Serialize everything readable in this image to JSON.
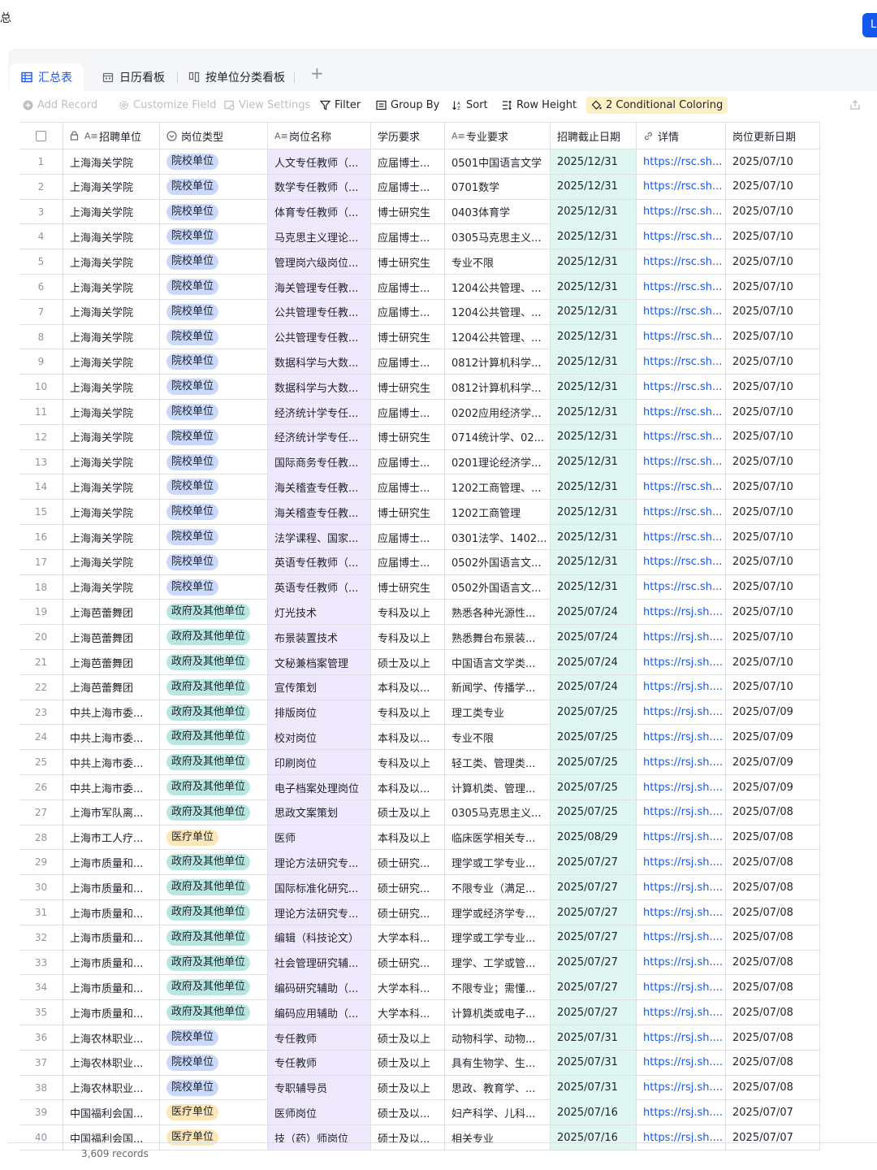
{
  "page": {
    "title": "总",
    "top_button": "L"
  },
  "tabs": [
    {
      "label": "汇总表",
      "icon": "grid-table-icon",
      "active": true
    },
    {
      "label": "日历看板",
      "icon": "calendar-icon",
      "active": false
    },
    {
      "label": "按单位分类看板",
      "icon": "kanban-icon",
      "active": false
    }
  ],
  "toolbar": {
    "add_record": "Add Record",
    "customize_field": "Customize Field",
    "view_settings": "View Settings",
    "filter": "Filter",
    "group_by": "Group By",
    "sort": "Sort",
    "row_height": "Row Height",
    "conditional_coloring": "2 Conditional Coloring"
  },
  "columns": [
    {
      "key": "unit",
      "label": "招聘单位",
      "icon": "lock-text-icon"
    },
    {
      "key": "type",
      "label": "岗位类型",
      "icon": "single-select-icon"
    },
    {
      "key": "name",
      "label": "岗位名称",
      "icon": "text-icon"
    },
    {
      "key": "edu",
      "label": "学历要求",
      "icon": ""
    },
    {
      "key": "major",
      "label": "专业要求",
      "icon": "text-icon"
    },
    {
      "key": "deadline",
      "label": "招聘截止日期",
      "icon": ""
    },
    {
      "key": "detail",
      "label": "详情",
      "icon": "link-icon"
    },
    {
      "key": "updated",
      "label": "岗位更新日期",
      "icon": ""
    }
  ],
  "tag_colors": {
    "院校单位": {
      "bg": "#c9d8fb",
      "fg": "#1f2329"
    },
    "政府及其他单位": {
      "bg": "#b8e6e1",
      "fg": "#1f2329"
    },
    "医疗单位": {
      "bg": "#fce7b8",
      "fg": "#1f2329"
    }
  },
  "rows": [
    [
      "1",
      "上海海关学院",
      "院校单位",
      "人文专任教师（...",
      "应届博士...",
      "0501中国语言文学",
      "2025/12/31",
      "https://rsc.sh...",
      "2025/07/10"
    ],
    [
      "2",
      "上海海关学院",
      "院校单位",
      "数学专任教师（...",
      "应届博士...",
      "0701数学",
      "2025/12/31",
      "https://rsc.sh...",
      "2025/07/10"
    ],
    [
      "3",
      "上海海关学院",
      "院校单位",
      "体育专任教师（...",
      "博士研究生",
      "0403体育学",
      "2025/12/31",
      "https://rsc.sh...",
      "2025/07/10"
    ],
    [
      "4",
      "上海海关学院",
      "院校单位",
      "马克思主义理论...",
      "应届博士...",
      "0305马克思主义...",
      "2025/12/31",
      "https://rsc.sh...",
      "2025/07/10"
    ],
    [
      "5",
      "上海海关学院",
      "院校单位",
      "管理岗六级岗位...",
      "博士研究生",
      "专业不限",
      "2025/12/31",
      "https://rsc.sh...",
      "2025/07/10"
    ],
    [
      "6",
      "上海海关学院",
      "院校单位",
      "海关管理专任教...",
      "应届博士...",
      "1204公共管理、...",
      "2025/12/31",
      "https://rsc.sh...",
      "2025/07/10"
    ],
    [
      "7",
      "上海海关学院",
      "院校单位",
      "公共管理专任教...",
      "应届博士...",
      "1204公共管理、...",
      "2025/12/31",
      "https://rsc.sh...",
      "2025/07/10"
    ],
    [
      "8",
      "上海海关学院",
      "院校单位",
      "公共管理专任教...",
      "博士研究生",
      "1204公共管理、...",
      "2025/12/31",
      "https://rsc.sh...",
      "2025/07/10"
    ],
    [
      "9",
      "上海海关学院",
      "院校单位",
      "数据科学与大数...",
      "应届博士...",
      "0812计算机科学...",
      "2025/12/31",
      "https://rsc.sh...",
      "2025/07/10"
    ],
    [
      "10",
      "上海海关学院",
      "院校单位",
      "数据科学与大数...",
      "博士研究生",
      "0812计算机科学...",
      "2025/12/31",
      "https://rsc.sh...",
      "2025/07/10"
    ],
    [
      "11",
      "上海海关学院",
      "院校单位",
      "经济统计学专任...",
      "应届博士...",
      "0202应用经济学...",
      "2025/12/31",
      "https://rsc.sh...",
      "2025/07/10"
    ],
    [
      "12",
      "上海海关学院",
      "院校单位",
      "经济统计学专任...",
      "博士研究生",
      "0714统计学、02...",
      "2025/12/31",
      "https://rsc.sh...",
      "2025/07/10"
    ],
    [
      "13",
      "上海海关学院",
      "院校单位",
      "国际商务专任教...",
      "应届博士...",
      "0201理论经济学...",
      "2025/12/31",
      "https://rsc.sh...",
      "2025/07/10"
    ],
    [
      "14",
      "上海海关学院",
      "院校单位",
      "海关稽查专任教...",
      "应届博士...",
      "1202工商管理、...",
      "2025/12/31",
      "https://rsc.sh...",
      "2025/07/10"
    ],
    [
      "15",
      "上海海关学院",
      "院校单位",
      "海关稽查专任教...",
      "博士研究生",
      "1202工商管理",
      "2025/12/31",
      "https://rsc.sh...",
      "2025/07/10"
    ],
    [
      "16",
      "上海海关学院",
      "院校单位",
      "法学课程、国家...",
      "应届博士...",
      "0301法学、1402...",
      "2025/12/31",
      "https://rsc.sh...",
      "2025/07/10"
    ],
    [
      "17",
      "上海海关学院",
      "院校单位",
      "英语专任教师（...",
      "应届博士...",
      "0502外国语言文...",
      "2025/12/31",
      "https://rsc.sh...",
      "2025/07/10"
    ],
    [
      "18",
      "上海海关学院",
      "院校单位",
      "英语专任教师（...",
      "博士研究生",
      "0502外国语言文...",
      "2025/12/31",
      "https://rsc.sh...",
      "2025/07/10"
    ],
    [
      "19",
      "上海芭蕾舞团",
      "政府及其他单位",
      "灯光技术",
      "专科及以上",
      "熟悉各种光源性...",
      "2025/07/24",
      "https://rsj.sh....",
      "2025/07/10"
    ],
    [
      "20",
      "上海芭蕾舞团",
      "政府及其他单位",
      "布景装置技术",
      "专科及以上",
      "熟悉舞台布景装...",
      "2025/07/24",
      "https://rsj.sh....",
      "2025/07/10"
    ],
    [
      "21",
      "上海芭蕾舞团",
      "政府及其他单位",
      "文秘兼档案管理",
      "硕士及以上",
      "中国语言文学类...",
      "2025/07/24",
      "https://rsj.sh....",
      "2025/07/10"
    ],
    [
      "22",
      "上海芭蕾舞团",
      "政府及其他单位",
      "宣传策划",
      "本科及以...",
      "新闻学、传播学...",
      "2025/07/24",
      "https://rsj.sh....",
      "2025/07/10"
    ],
    [
      "23",
      "中共上海市委...",
      "政府及其他单位",
      "排版岗位",
      "专科及以上",
      "理工类专业",
      "2025/07/25",
      "https://rsj.sh....",
      "2025/07/09"
    ],
    [
      "24",
      "中共上海市委...",
      "政府及其他单位",
      "校对岗位",
      "本科及以...",
      "专业不限",
      "2025/07/25",
      "https://rsj.sh....",
      "2025/07/09"
    ],
    [
      "25",
      "中共上海市委...",
      "政府及其他单位",
      "印刷岗位",
      "专科及以上",
      "轻工类、管理类...",
      "2025/07/25",
      "https://rsj.sh....",
      "2025/07/09"
    ],
    [
      "26",
      "中共上海市委...",
      "政府及其他单位",
      "电子档案处理岗位",
      "本科及以...",
      "计算机类、管理...",
      "2025/07/25",
      "https://rsj.sh....",
      "2025/07/09"
    ],
    [
      "27",
      "上海市军队离...",
      "政府及其他单位",
      "思政文案策划",
      "硕士及以上",
      "0305马克思主义...",
      "2025/07/25",
      "https://rsj.sh....",
      "2025/07/08"
    ],
    [
      "28",
      "上海市工人疗...",
      "医疗单位",
      "医师",
      "本科及以上",
      "临床医学相关专...",
      "2025/08/29",
      "https://rsj.sh....",
      "2025/07/08"
    ],
    [
      "29",
      "上海市质量和...",
      "政府及其他单位",
      "理论方法研究专...",
      "硕士研究...",
      "理学或工学专业...",
      "2025/07/27",
      "https://rsj.sh....",
      "2025/07/08"
    ],
    [
      "30",
      "上海市质量和...",
      "政府及其他单位",
      "国际标准化研究...",
      "硕士研究...",
      "不限专业（满足...",
      "2025/07/27",
      "https://rsj.sh....",
      "2025/07/08"
    ],
    [
      "31",
      "上海市质量和...",
      "政府及其他单位",
      "理论方法研究专...",
      "硕士研究...",
      "理学或经济学专...",
      "2025/07/27",
      "https://rsj.sh....",
      "2025/07/08"
    ],
    [
      "32",
      "上海市质量和...",
      "政府及其他单位",
      "编辑（科技论文）",
      "大学本科...",
      "理学或工学专业...",
      "2025/07/27",
      "https://rsj.sh....",
      "2025/07/08"
    ],
    [
      "33",
      "上海市质量和...",
      "政府及其他单位",
      "社会管理研究辅...",
      "硕士研究...",
      "理学、工学或管...",
      "2025/07/27",
      "https://rsj.sh....",
      "2025/07/08"
    ],
    [
      "34",
      "上海市质量和...",
      "政府及其他单位",
      "编码研究辅助（...",
      "大学本科...",
      "不限专业；需懂...",
      "2025/07/27",
      "https://rsj.sh....",
      "2025/07/08"
    ],
    [
      "35",
      "上海市质量和...",
      "政府及其他单位",
      "编码应用辅助（...",
      "大学本科...",
      "计算机类或电子...",
      "2025/07/27",
      "https://rsj.sh....",
      "2025/07/08"
    ],
    [
      "36",
      "上海农林职业...",
      "院校单位",
      "专任教师",
      "硕士及以上",
      "动物科学、动物...",
      "2025/07/31",
      "https://rsj.sh....",
      "2025/07/08"
    ],
    [
      "37",
      "上海农林职业...",
      "院校单位",
      "专任教师",
      "硕士及以上",
      "具有生物学、生...",
      "2025/07/31",
      "https://rsj.sh....",
      "2025/07/08"
    ],
    [
      "38",
      "上海农林职业...",
      "院校单位",
      "专职辅导员",
      "硕士及以上",
      "思政、教育学、...",
      "2025/07/31",
      "https://rsj.sh....",
      "2025/07/08"
    ],
    [
      "39",
      "中国福利会国...",
      "医疗单位",
      "医师岗位",
      "硕士及以...",
      "妇产科学、儿科...",
      "2025/07/16",
      "https://rsj.sh....",
      "2025/07/07"
    ],
    [
      "40",
      "中国福利会国...",
      "医疗单位",
      "技（药）师岗位",
      "硕士及以...",
      "相关专业",
      "2025/07/16",
      "https://rsj.sh....",
      "2025/07/07"
    ]
  ],
  "footer": {
    "record_count": "3,609 records"
  }
}
